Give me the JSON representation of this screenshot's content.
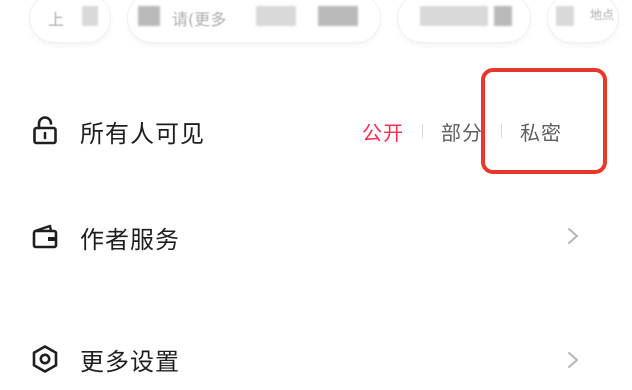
{
  "top_chips": [
    {
      "text": "上"
    },
    {
      "text": "请(更多"
    },
    {
      "text": ""
    },
    {
      "text": "地点"
    }
  ],
  "visibility_row": {
    "icon": "unlock-icon",
    "label": "所有人可见",
    "options": [
      {
        "label": "公开",
        "selected": true
      },
      {
        "label": "部分",
        "selected": false
      },
      {
        "label": "私密",
        "selected": false
      }
    ]
  },
  "author_row": {
    "icon": "wallet-icon",
    "label": "作者服务",
    "chevron": "chevron-right-icon"
  },
  "more_row": {
    "icon": "hexagon-settings-icon",
    "label": "更多设置",
    "chevron": "chevron-right-icon"
  },
  "colors": {
    "accent": "#fe2c55",
    "highlight": "#e8382b",
    "text": "#1f1f1f",
    "muted": "#5f5f5f"
  }
}
